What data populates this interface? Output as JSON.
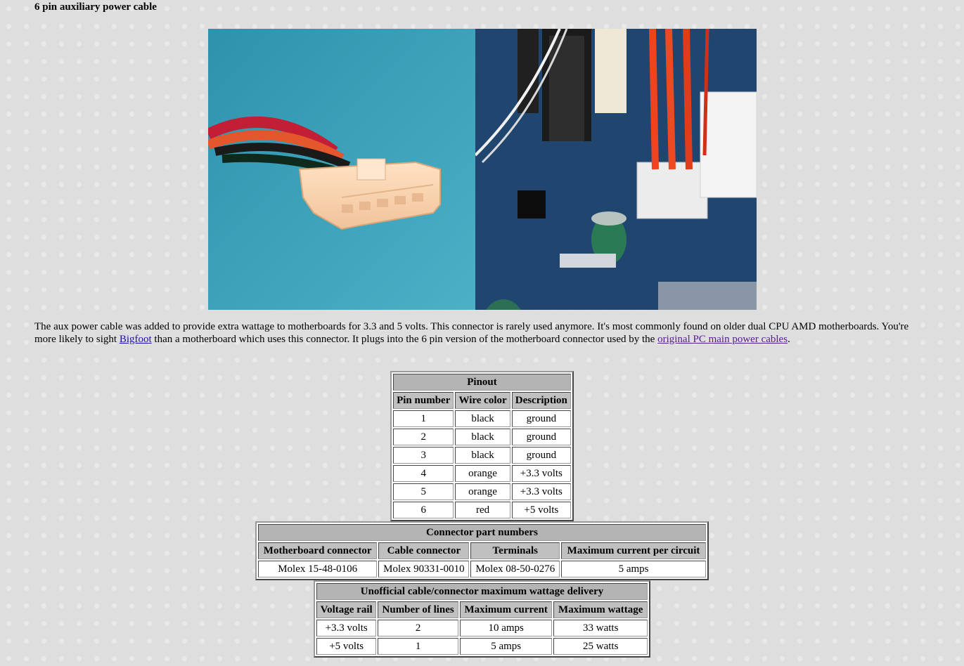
{
  "page": {
    "title": "6 pin auxiliary power cable"
  },
  "photo": {
    "alt": "6 pin auxiliary power connector and motherboard header"
  },
  "intro": {
    "text_1": "The aux power cable was added to provide extra wattage to motherboards for 3.3 and 5 volts. This connector is rarely used anymore. It's most commonly found on older dual CPU AMD motherboards. You're more likely to sight ",
    "link_1": "Bigfoot",
    "text_2": " than a motherboard which uses this connector. It plugs into the 6 pin version of the motherboard connector used by the ",
    "link_2": "original PC main power cables",
    "text_3": "."
  },
  "pinout": {
    "caption": "Pinout",
    "headers": [
      "Pin number",
      "Wire color",
      "Description"
    ],
    "rows": [
      [
        "1",
        "black",
        "ground"
      ],
      [
        "2",
        "black",
        "ground"
      ],
      [
        "3",
        "black",
        "ground"
      ],
      [
        "4",
        "orange",
        "+3.3 volts"
      ],
      [
        "5",
        "orange",
        "+3.3 volts"
      ],
      [
        "6",
        "red",
        "+5 volts"
      ]
    ]
  },
  "part_numbers": {
    "caption": "Connector part numbers",
    "headers": [
      "Motherboard connector",
      "Cable connector",
      "Terminals",
      "Maximum current per circuit"
    ],
    "rows": [
      [
        "Molex 15-48-0106",
        "Molex 90331-0010",
        "Molex 08-50-0276",
        "5 amps"
      ]
    ]
  },
  "wattage": {
    "caption": "Unofficial cable/connector maximum wattage delivery",
    "headers": [
      "Voltage rail",
      "Number of lines",
      "Maximum current",
      "Maximum wattage"
    ],
    "rows": [
      [
        "+3.3 volts",
        "2",
        "10 amps",
        "33 watts"
      ],
      [
        "+5 volts",
        "1",
        "5 amps",
        "25 watts"
      ]
    ]
  },
  "colors": {
    "link": "#1a0dab",
    "visited_link": "#551a8b",
    "header_bg": "#c0c0c0",
    "page_bg": "#dedede"
  }
}
